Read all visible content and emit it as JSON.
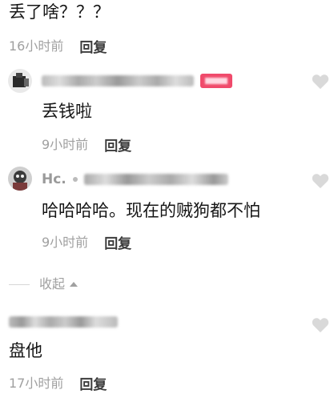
{
  "comments": [
    {
      "text": "丢了啥？？？",
      "time": "16小时前",
      "reply": "回复"
    },
    {
      "text": "丢钱啦",
      "time": "9小时前",
      "reply": "回复"
    },
    {
      "name": "Hc.",
      "text": "哈哈哈哈。现在的贼狗都不怕",
      "time": "9小时前",
      "reply": "回复"
    },
    {
      "text": "盘他",
      "time": "17小时前",
      "reply": "回复"
    }
  ],
  "collapse_label": "收起",
  "colors": {
    "badge": "#f04a6b",
    "meta": "#a0a0a0",
    "heart": "#d9d9d9"
  },
  "icons": [
    "heart-icon",
    "caret-up-icon",
    "avatar"
  ]
}
